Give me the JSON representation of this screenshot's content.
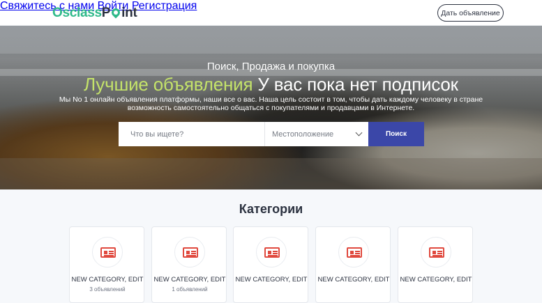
{
  "header": {
    "logo_part1": "Osclass",
    "logo_part2": "P",
    "logo_part3": "int",
    "nav": {
      "contact": "Свяжитесь с нами",
      "login": "Войти",
      "register": "Регистрация"
    },
    "post_button": "Дать объявление"
  },
  "hero": {
    "subtitle": "Поиск, Продажа и покупка",
    "title_highlight": "Лучшие объявления",
    "title_rest": "У вас пока нет подписок",
    "description": "Мы No 1 онлайн объявления платформы, наши все о вас. Наша цель состоит в том, чтобы дать каждому человеку в стране возможность самостоятельно общаться с покупателями и продавцами в Интернете."
  },
  "search": {
    "query_placeholder": "Что вы ищете?",
    "location_selected": "Местоположение",
    "button": "Поиск"
  },
  "categories": {
    "title": "Категории",
    "items": [
      {
        "name": "NEW CATEGORY, EDIT",
        "count": "3 объявлений",
        "icon": "newspaper-icon"
      },
      {
        "name": "NEW CATEGORY, EDIT",
        "count": "1 объявлений",
        "icon": "newspaper-icon"
      },
      {
        "name": "NEW CATEGORY, EDIT",
        "count": "",
        "icon": "newspaper-icon"
      },
      {
        "name": "NEW CATEGORY, EDIT",
        "count": "",
        "icon": "newspaper-icon"
      },
      {
        "name": "NEW CATEGORY, EDIT",
        "count": "",
        "icon": "newspaper-icon"
      }
    ]
  },
  "colors": {
    "brand_green": "#2fb98a",
    "highlight": "#c4e36a",
    "search_button": "#3b47a8",
    "category_icon": "#e0493e"
  }
}
